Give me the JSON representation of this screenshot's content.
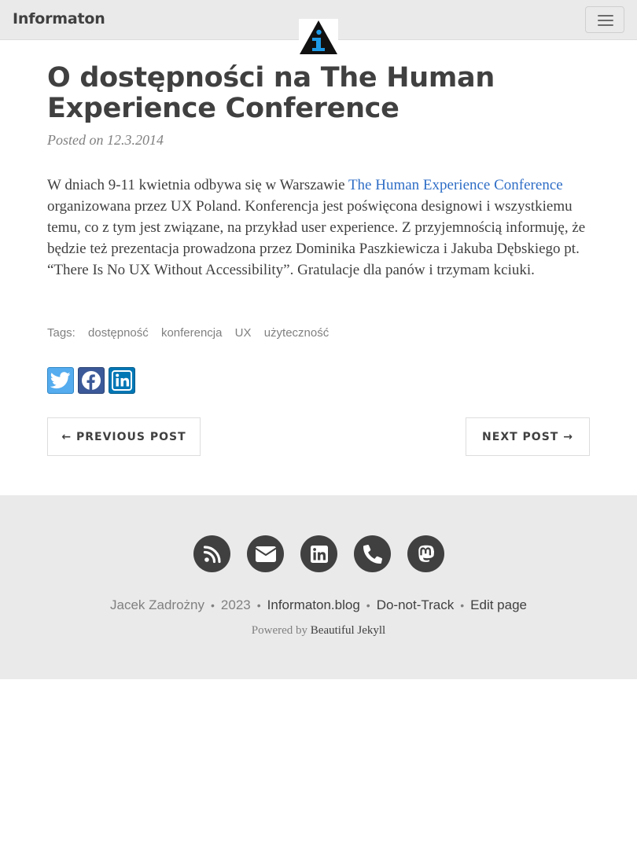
{
  "navbar": {
    "brand": "Informaton",
    "logo_icon": "info-triangle-logo-icon",
    "menu_icon": "hamburger-menu-icon"
  },
  "post": {
    "title": "O dostępności na The Human Experience Conference",
    "meta": "Posted on 12.3.2014",
    "body_before_link": "W dniach 9-11 kwietnia odbywa się w Warszawie ",
    "body_link": "The Human Experience Conference",
    "body_after_link": " organizowana przez UX Poland. Konferencja jest poświęcona designowi i wszystkiemu temu, co z tym jest związane, na przykład user experience. Z przyjemnością informuję, że będzie też prezentacja prowadzona przez Dominika Paszkiewicza i Jakuba Dębskiego pt. “There Is No UX Without Accessibility”. Gratulacje dla panów i trzymam kciuki.",
    "tags_label": "Tags:",
    "tags": [
      "dostępność",
      "konferencja",
      "UX",
      "użyteczność"
    ],
    "share": [
      "twitter-icon",
      "facebook-icon",
      "linkedin-icon"
    ],
    "prev_label": "← PREVIOUS POST",
    "next_label": "NEXT POST →"
  },
  "footer": {
    "social": [
      "rss-icon",
      "envelope-icon",
      "linkedin-icon",
      "phone-icon",
      "mastodon-icon"
    ],
    "author": "Jacek Zadrożny",
    "year": "2023",
    "site_link": "Informaton.blog",
    "dnt_link": "Do-not-Track",
    "edit_link": "Edit page",
    "separator": "•",
    "powered_prefix": "Powered by",
    "powered_link": "Beautiful Jekyll"
  },
  "colors": {
    "link": "#2f6ec6",
    "text": "#404040",
    "muted": "#808080",
    "footer_bg": "#eaeaea",
    "logo_blue": "#1e9be8"
  }
}
